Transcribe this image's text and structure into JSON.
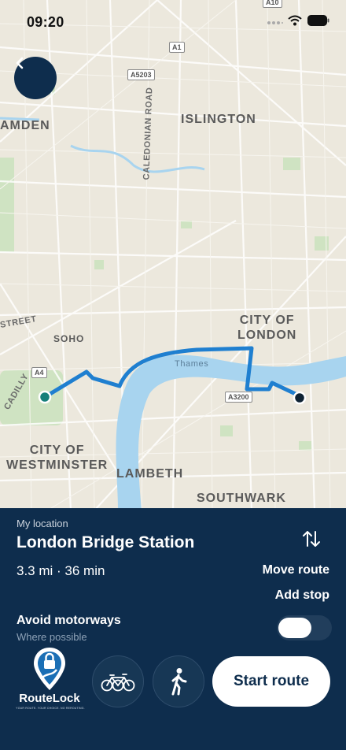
{
  "status_bar": {
    "time": "09:20"
  },
  "map": {
    "labels": {
      "camden": "AMDEN",
      "islington": "ISLINGTON",
      "city_of_london": "CITY OF\nLONDON",
      "soho": "SOHO",
      "city_of_westminster": "CITY OF\nWESTMINSTER",
      "lambeth": "LAMBETH",
      "southwark": "SOUTHWARK",
      "thames": "Thames",
      "street": "STREET",
      "caledonian_road": "CALEDONIAN ROAD",
      "cadilly": "CADILLY"
    },
    "road_shields": {
      "a1": "A1",
      "a5203": "A5203",
      "a4": "A4",
      "a3200": "A3200",
      "a10": "A10"
    }
  },
  "route": {
    "from_label": "My location",
    "destination": "London Bridge Station",
    "summary": "3.3 mi · 36 min",
    "move_route": "Move route",
    "add_stop": "Add stop",
    "avoid_label": "Avoid motorways",
    "avoid_sub": "Where possible",
    "avoid_enabled": false,
    "start_label": "Start route"
  },
  "brand": {
    "name": "RouteLock",
    "tagline": "YOUR ROUTE. YOUR CHOICE. NO REROUTING.",
    "accent": "#0e2d4d",
    "route_color": "#1f7fd0"
  },
  "icons": [
    "back-icon",
    "swap-icon",
    "bike-icon",
    "walk-icon",
    "wifi-icon",
    "battery-icon",
    "signal-icon"
  ]
}
